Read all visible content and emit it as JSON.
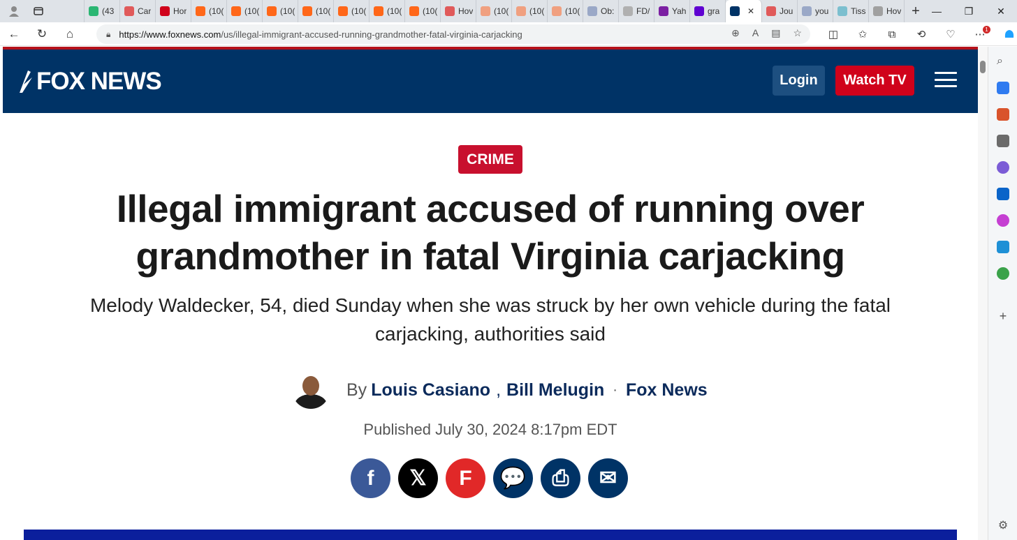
{
  "browser": {
    "tabs": [
      {
        "label": "",
        "color": "#dfe3e8"
      },
      {
        "label": "(43",
        "color": "#2bb673"
      },
      {
        "label": "Car",
        "color": "#e05a5a"
      },
      {
        "label": "Hor",
        "color": "#d0021b"
      },
      {
        "label": "(10(",
        "color": "#ff6719"
      },
      {
        "label": "(10(",
        "color": "#ff6719"
      },
      {
        "label": "(10(",
        "color": "#ff6719"
      },
      {
        "label": "(10(",
        "color": "#ff6719"
      },
      {
        "label": "(10(",
        "color": "#ff6719"
      },
      {
        "label": "(10(",
        "color": "#ff6719"
      },
      {
        "label": "(10(",
        "color": "#ff6719"
      },
      {
        "label": "Hov",
        "color": "#e05a5a"
      },
      {
        "label": "(10(",
        "color": "#f0a080"
      },
      {
        "label": "(10(",
        "color": "#f0a080"
      },
      {
        "label": "(10(",
        "color": "#f0a080"
      },
      {
        "label": "Ob:",
        "color": "#9aa8c7"
      },
      {
        "label": "FD/",
        "color": "#b0b0b0"
      },
      {
        "label": "Yah",
        "color": "#7b1fa2"
      },
      {
        "label": "gra",
        "color": "#5f01d1"
      },
      {
        "label": "",
        "color": "#003366",
        "active": true
      },
      {
        "label": "Jou",
        "color": "#e05a5a"
      },
      {
        "label": "you",
        "color": "#9aa8c7"
      },
      {
        "label": "Tiss",
        "color": "#7cbfcf"
      },
      {
        "label": "Hov",
        "color": "#a0a0a0"
      }
    ],
    "url_host": "https://www.foxnews.com",
    "url_path": "/us/illegal-immigrant-accused-running-grandmother-fatal-virginia-carjacking",
    "notification_count": "1"
  },
  "site": {
    "logo_text": "FOX NEWS",
    "login_label": "Login",
    "watch_label": "Watch TV"
  },
  "article": {
    "category": "CRIME",
    "headline_line1": "Illegal immigrant accused of running over",
    "headline_line2": "grandmother in fatal Virginia carjacking",
    "dek": "Melody Waldecker, 54, died Sunday when she was struck by her own vehicle during the fatal carjacking, authorities said",
    "by_prefix": "By",
    "author1": "Louis Casiano",
    "author_sep": ",",
    "author2": "Bill Melugin",
    "dot": "·",
    "source": "Fox News",
    "published": "Published July 30, 2024 8:17pm EDT"
  },
  "share": {
    "facebook": {
      "glyph": "f",
      "color": "#3b5998"
    },
    "x": {
      "glyph": "𝕏",
      "color": "#000000"
    },
    "flipboard": {
      "glyph": "F",
      "color": "#e12828"
    },
    "comments": {
      "glyph": "💬",
      "color": "#003366"
    },
    "print": {
      "glyph": "⎙",
      "color": "#003366"
    },
    "email": {
      "glyph": "✉",
      "color": "#003366"
    }
  },
  "colors": {
    "header": "#003366",
    "accent_red": "#c8102e",
    "author_blue": "#0b2a5b"
  }
}
